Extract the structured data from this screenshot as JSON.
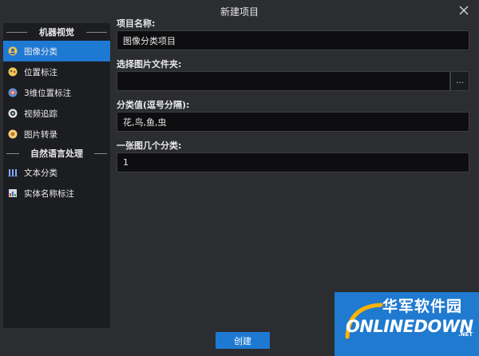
{
  "window": {
    "title": "新建项目"
  },
  "sidebar": {
    "groups": [
      {
        "label": "机器视觉",
        "items": [
          {
            "label": "图像分类",
            "icon": "image-classify-icon",
            "active": true
          },
          {
            "label": "位置标注",
            "icon": "position-label-icon",
            "active": false
          },
          {
            "label": "3维位置标注",
            "icon": "3d-position-label-icon",
            "active": false
          },
          {
            "label": "视频追踪",
            "icon": "video-tracking-icon",
            "active": false
          },
          {
            "label": "图片转录",
            "icon": "image-transcribe-icon",
            "active": false
          }
        ]
      },
      {
        "label": "自然语言处理",
        "items": [
          {
            "label": "文本分类",
            "icon": "text-classify-icon",
            "active": false
          },
          {
            "label": "实体名称标注",
            "icon": "entity-name-label-icon",
            "active": false
          }
        ]
      }
    ]
  },
  "form": {
    "project_name": {
      "label": "项目名称:",
      "value": "图像分类项目"
    },
    "folder": {
      "label": "选择图片文件夹:",
      "value": "",
      "browse_label": "..."
    },
    "categories": {
      "label": "分类值(逗号分隔):",
      "value": "花,鸟,鱼,虫"
    },
    "per_image": {
      "label": "一张图几个分类:",
      "value": "1"
    }
  },
  "footer": {
    "create_label": "创建"
  },
  "watermark": {
    "cn_text": "华军软件园",
    "en_text": "ONLINEDOWN",
    "suffix": ".NET"
  },
  "colors": {
    "accent": "#1e79d3",
    "background": "#2b2d31",
    "sidebar": "#1c1d21",
    "input": "#0e0e10"
  }
}
